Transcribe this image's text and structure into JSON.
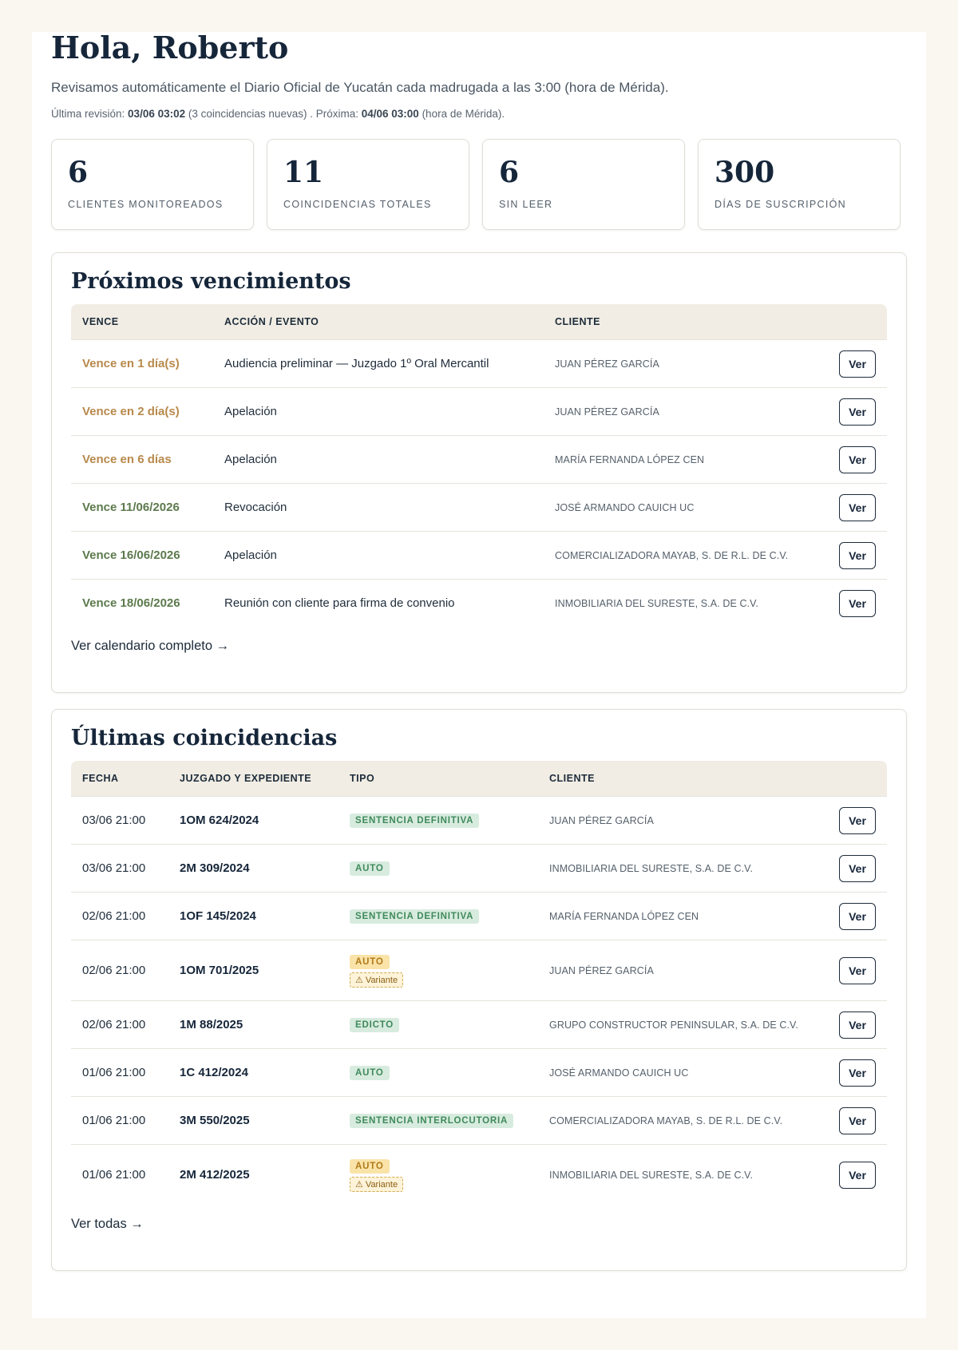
{
  "header": {
    "greeting": "Hola, Roberto",
    "intro": "Revisamos automáticamente el Diario Oficial de Yucatán cada madrugada a las 3:00 (hora de Mérida).",
    "last_label": "Última revisión:",
    "last_value": "03/06 03:02",
    "last_note": "(3 coincidencias nuevas) . Próxima:",
    "next_value": "04/06 03:00",
    "next_note": "(hora de Mérida)."
  },
  "stats": [
    {
      "value": "6",
      "label": "CLIENTES MONITOREADOS"
    },
    {
      "value": "11",
      "label": "COINCIDENCIAS TOTALES"
    },
    {
      "value": "6",
      "label": "SIN LEER"
    },
    {
      "value": "300",
      "label": "DÍAS DE SUSCRIPCIÓN"
    }
  ],
  "vencimientos": {
    "title": "Próximos vencimientos",
    "headers": {
      "vence": "VENCE",
      "accion": "ACCIÓN / EVENTO",
      "cliente": "CLIENTE"
    },
    "rows": [
      {
        "vence": "Vence en 1 día(s)",
        "accion": "Audiencia preliminar — Juzgado 1º Oral Mercantil",
        "cliente": "JUAN PÉREZ GARCÍA",
        "ver": "Ver"
      },
      {
        "vence": "Vence en 2 día(s)",
        "accion": "Apelación",
        "cliente": "JUAN PÉREZ GARCÍA",
        "ver": "Ver"
      },
      {
        "vence": "Vence en 6 días",
        "accion": "Apelación",
        "cliente": "MARÍA FERNANDA LÓPEZ CEN",
        "ver": "Ver"
      },
      {
        "vence": "Vence 11/06/2026",
        "accion": "Revocación",
        "cliente": "JOSÉ ARMANDO CAUICH UC",
        "ver": "Ver"
      },
      {
        "vence": "Vence 16/06/2026",
        "accion": "Apelación",
        "cliente": "COMERCIALIZADORA MAYAB, S. DE R.L. DE C.V.",
        "ver": "Ver"
      },
      {
        "vence": "Vence 18/06/2026",
        "accion": "Reunión con cliente para firma de convenio",
        "cliente": "INMOBILIARIA DEL SURESTE, S.A. DE C.V.",
        "ver": "Ver"
      }
    ],
    "link": "Ver calendario completo →"
  },
  "coincidencias": {
    "title": "Últimas coincidencias",
    "headers": {
      "fecha": "FECHA",
      "juzgado": "JUZGADO Y EXPEDIENTE",
      "tipo": "TIPO",
      "cliente": "CLIENTE"
    },
    "rows": [
      {
        "fecha": "03/06 21:00",
        "expediente": "1OM 624/2024",
        "tipo": "SENTENCIA DEFINITIVA",
        "cliente": "JUAN PÉREZ GARCÍA",
        "ver": "Ver"
      },
      {
        "fecha": "03/06 21:00",
        "expediente": "2M 309/2024",
        "tipo": "AUTO",
        "cliente": "INMOBILIARIA DEL SURESTE, S.A. DE C.V.",
        "ver": "Ver"
      },
      {
        "fecha": "02/06 21:00",
        "expediente": "1OF 145/2024",
        "tipo": "SENTENCIA DEFINITIVA",
        "cliente": "MARÍA FERNANDA LÓPEZ CEN",
        "ver": "Ver"
      },
      {
        "fecha": "02/06 21:00",
        "expediente": "1OM 701/2025",
        "tipo": "AUTO",
        "variante": "⚠ Variante",
        "cliente": "JUAN PÉREZ GARCÍA",
        "ver": "Ver"
      },
      {
        "fecha": "02/06 21:00",
        "expediente": "1M 88/2025",
        "tipo": "EDICTO",
        "cliente": "GRUPO CONSTRUCTOR PENINSULAR, S.A. DE C.V.",
        "ver": "Ver"
      },
      {
        "fecha": "01/06 21:00",
        "expediente": "1C 412/2024",
        "tipo": "AUTO",
        "cliente": "JOSÉ ARMANDO CAUICH UC",
        "ver": "Ver"
      },
      {
        "fecha": "01/06 21:00",
        "expediente": "3M 550/2025",
        "tipo": "SENTENCIA INTERLOCUTORIA",
        "cliente": "COMERCIALIZADORA MAYAB, S. DE R.L. DE C.V.",
        "ver": "Ver"
      },
      {
        "fecha": "01/06 21:00",
        "expediente": "2M 412/2025",
        "tipo": "AUTO",
        "variante": "⚠ Variante",
        "cliente": "INMOBILIARIA DEL SURESTE, S.A. DE C.V.",
        "ver": "Ver"
      }
    ],
    "link": "Ver todas →"
  }
}
